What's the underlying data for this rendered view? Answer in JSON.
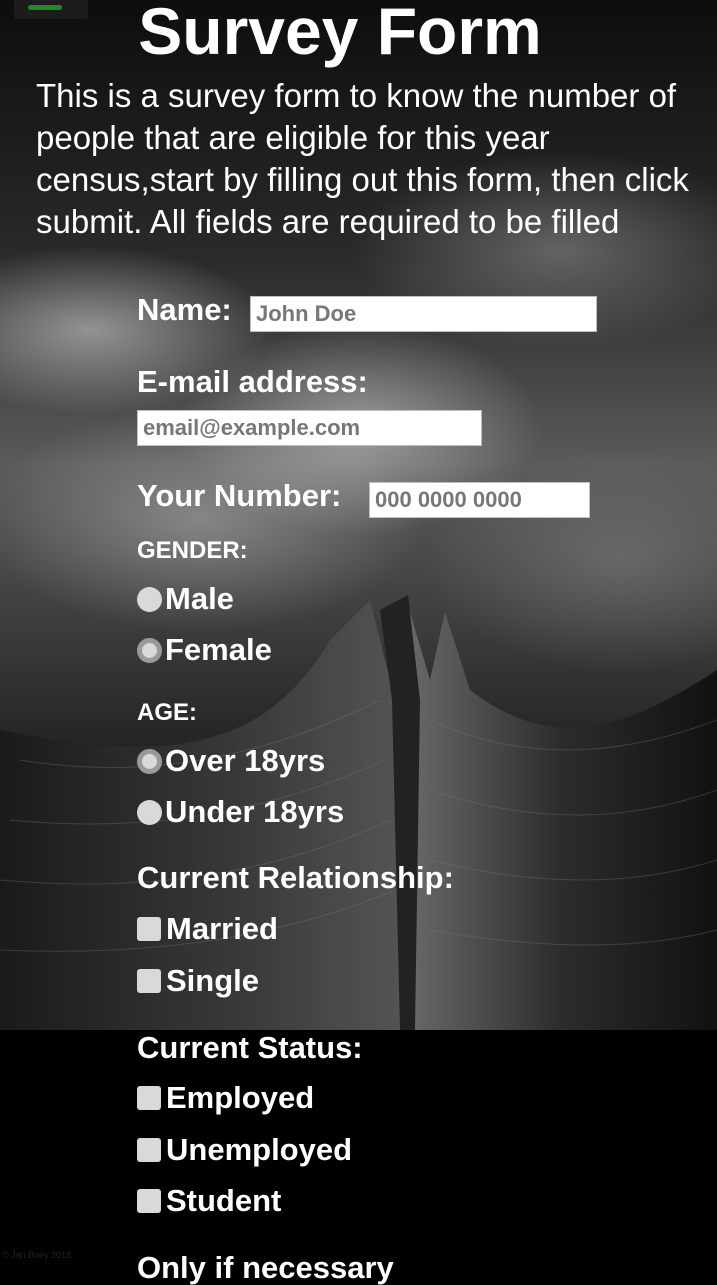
{
  "page": {
    "title": "Survey Form",
    "description": "This is a survey form to know the number of people that are eligible for this year census,start by filling out this form, then click submit. All fields are required to be filled",
    "credit": "© Jan Boey 2018"
  },
  "form": {
    "name": {
      "label": "Name:",
      "placeholder": "John Doe"
    },
    "email": {
      "label": "E-mail address:",
      "placeholder": "email@example.com"
    },
    "number": {
      "label": "Your Number:",
      "placeholder": "000 0000 0000"
    },
    "gender": {
      "label": "GENDER:",
      "options": [
        {
          "label": "Male",
          "style": "plain"
        },
        {
          "label": "Female",
          "style": "ring"
        }
      ]
    },
    "age": {
      "label": "AGE:",
      "options": [
        {
          "label": "Over 18yrs",
          "style": "ring"
        },
        {
          "label": "Under 18yrs",
          "style": "plain"
        }
      ]
    },
    "relationship": {
      "label": "Current Relationship:",
      "options": [
        "Married",
        "Single"
      ]
    },
    "status": {
      "label": "Current Status:",
      "options": [
        "Employed",
        "Unemployed",
        "Student"
      ]
    },
    "extra": {
      "label": "Only if necessary"
    }
  },
  "colors": {
    "toggle_accent": "#1f8a2a",
    "background": "#000000",
    "text": "#ffffff",
    "control": "#d9d9d9"
  }
}
